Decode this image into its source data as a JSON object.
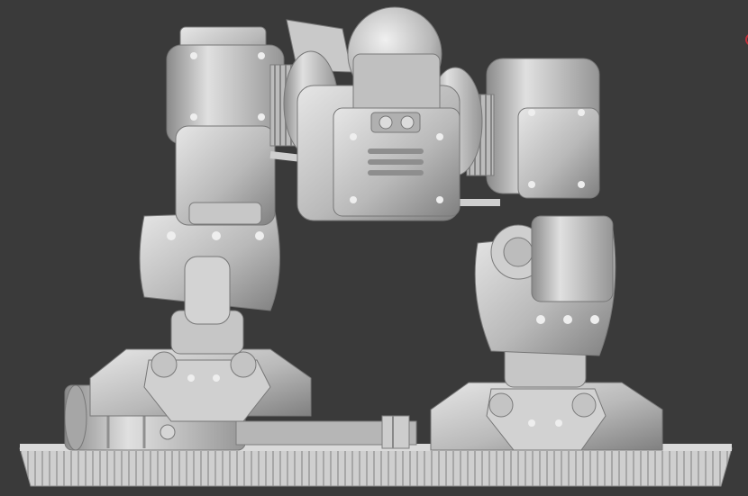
{
  "scene": {
    "background_color": "#3a3a3a",
    "model_base_color": "#bdbdbd",
    "model_highlight_color": "#e4e4e4",
    "model_shadow_color": "#7c7c7c",
    "edge_marker_color": "#c0303a"
  }
}
